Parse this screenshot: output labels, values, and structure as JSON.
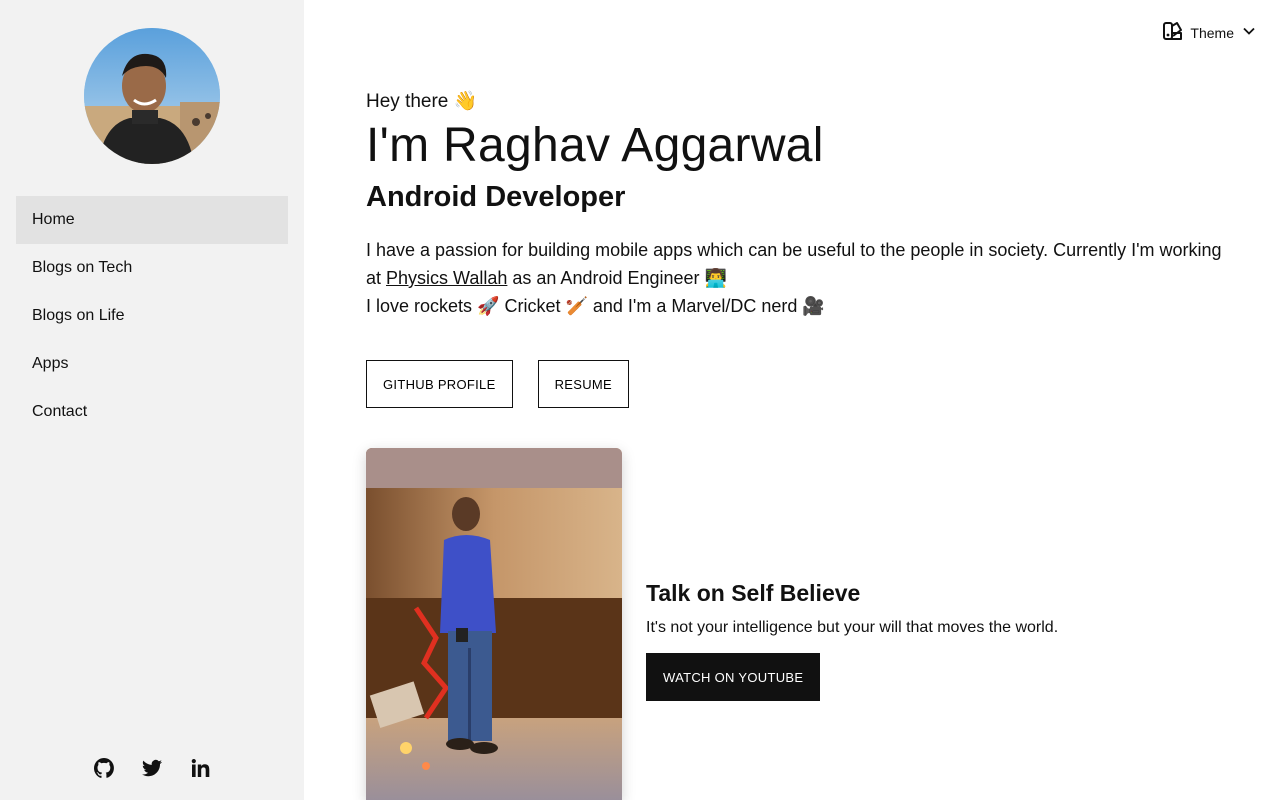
{
  "sidebar": {
    "avatar_alt": "profile photo",
    "nav": [
      {
        "label": "Home",
        "active": true
      },
      {
        "label": "Blogs on Tech"
      },
      {
        "label": "Blogs on Life"
      },
      {
        "label": "Apps"
      },
      {
        "label": "Contact"
      }
    ],
    "socials": [
      {
        "icon": "github-icon"
      },
      {
        "icon": "twitter-icon"
      },
      {
        "icon": "linkedin-icon"
      }
    ]
  },
  "header": {
    "theme_label": "Theme"
  },
  "hero": {
    "greeting": "Hey there 👋",
    "name": "I'm Raghav Aggarwal",
    "role": "Android Developer",
    "bio_line1_pre": "I have a passion for building mobile apps which can be useful to the people in society. Currently I'm working at ",
    "bio_link": "Physics Wallah",
    "bio_line1_post": " as an Android Engineer 👨‍💻",
    "bio_line2": "I love rockets 🚀 Cricket 🏏 and I'm a Marvel/DC nerd 🎥",
    "github_button": "GITHUB PROFILE",
    "resume_button": "RESUME"
  },
  "talk": {
    "title": "Talk on Self Believe",
    "description": "It's not your intelligence but your will that moves the world.",
    "button": "WATCH ON YOUTUBE"
  },
  "colors": {
    "sidebar_bg": "#f2f2f2",
    "active_nav_bg": "#e2e2e2",
    "text": "#111111",
    "dark_button": "#111111"
  }
}
